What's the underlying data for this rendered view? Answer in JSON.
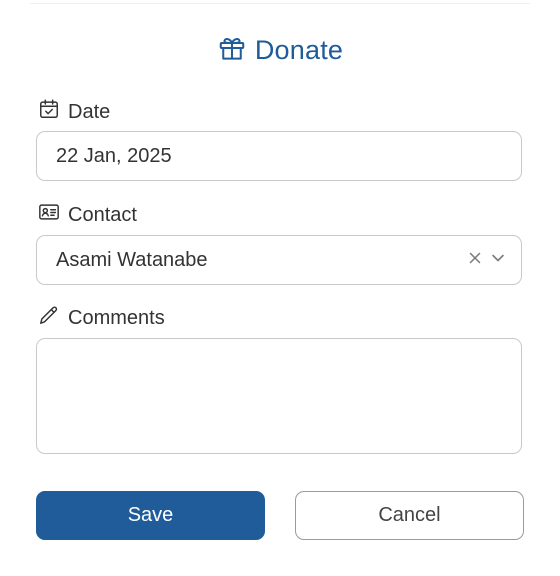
{
  "dialog": {
    "title": "Donate",
    "title_icon": "gift-icon",
    "accent_color": "#1f5c99"
  },
  "date_field": {
    "label": "Date",
    "icon": "calendar-check-icon",
    "value": "22 Jan, 2025"
  },
  "contact_field": {
    "label": "Contact",
    "icon": "contact-card-icon",
    "value": "Asami Watanabe",
    "clear_icon": "close-icon",
    "dropdown_icon": "chevron-down-icon"
  },
  "comments_field": {
    "label": "Comments",
    "icon": "pencil-icon",
    "value": ""
  },
  "actions": {
    "save_label": "Save",
    "cancel_label": "Cancel"
  }
}
